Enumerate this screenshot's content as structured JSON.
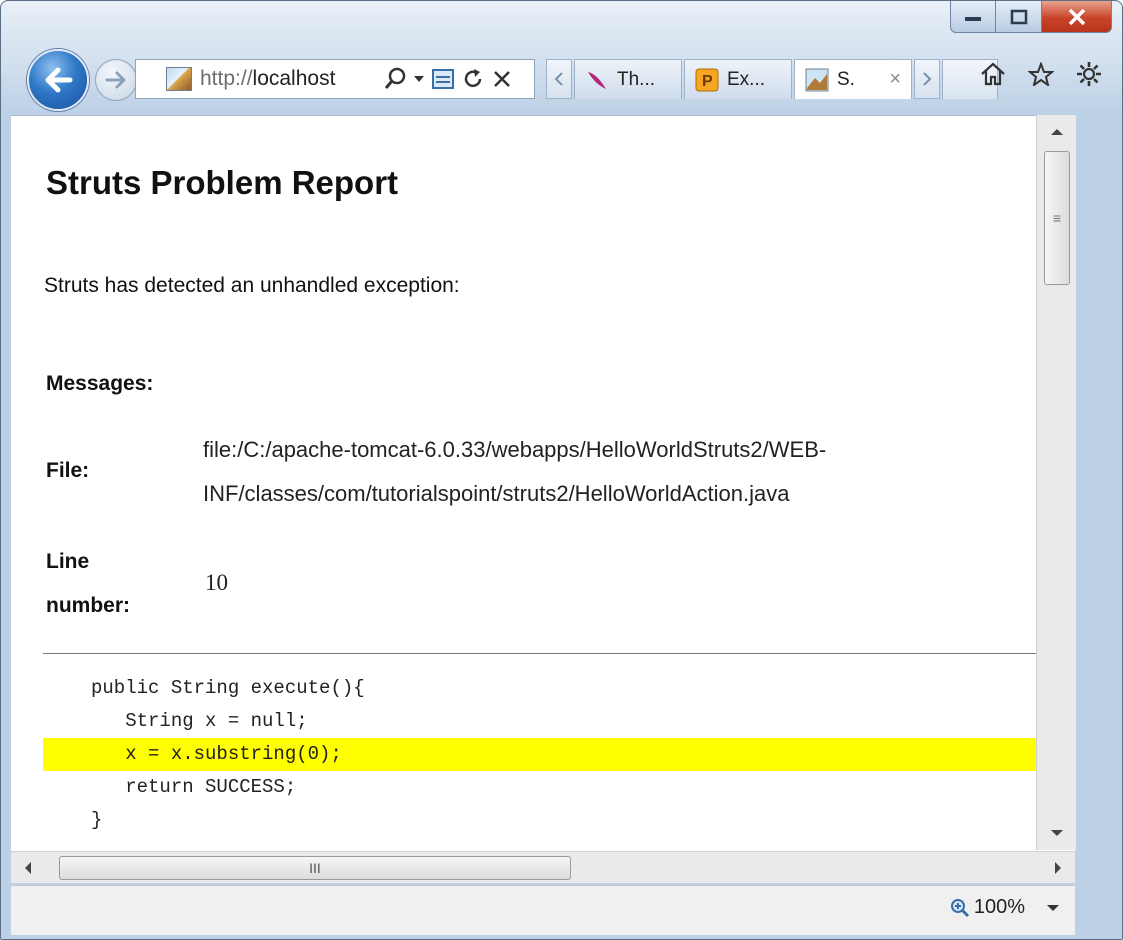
{
  "browser": {
    "address": {
      "protocol": "http://",
      "host": "localhost"
    },
    "tabs": [
      {
        "label": "Th...",
        "icon": "feather-icon"
      },
      {
        "label": "Ex...",
        "icon": "p-icon"
      },
      {
        "label": "S.",
        "icon": "tomcat-icon",
        "close": "×",
        "active": true
      }
    ]
  },
  "page": {
    "title": "Struts Problem Report",
    "intro": "Struts has detected an unhandled exception:",
    "messages_label": "Messages:",
    "file_label": "File:",
    "file_value": "file:/C:/apache-tomcat-6.0.33/webapps/HelloWorldStruts2/WEB-INF/classes/com/tutorialspoint/struts2/HelloWorldAction.java",
    "line_label": "Line number:",
    "line_value": "10",
    "code": [
      "public String execute(){",
      "   String x = null;",
      "   x = x.substring(0);",
      "   return SUCCESS;",
      "}"
    ],
    "highlight_color": "#ffff00"
  },
  "scrollbar": {
    "thumb_grip": "≡",
    "h_grip": "III"
  },
  "status": {
    "zoom": "100%"
  },
  "colors": {
    "close_button": "#c8452a",
    "back_button": "#2f78c8"
  }
}
